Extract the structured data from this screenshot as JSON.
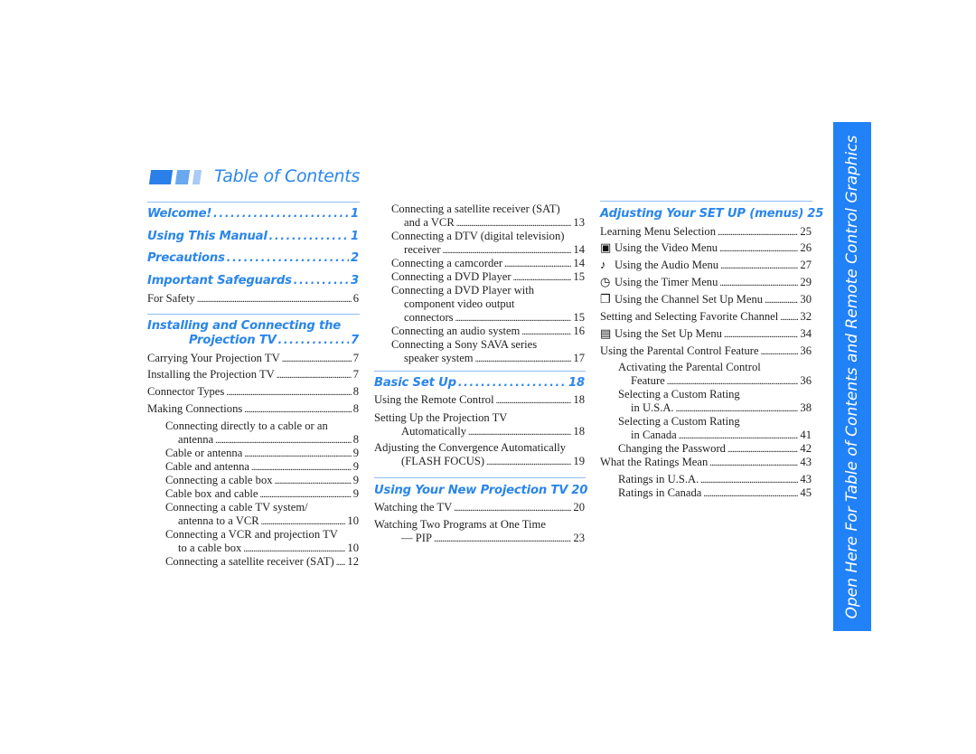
{
  "title": "Table of Contents",
  "side_tab": "Open Here For Table of Contents and Remote Control Graphics",
  "colors": {
    "accent": "#2a86ea",
    "tab": "#2181f7"
  },
  "columns": [
    {
      "entries": [
        {
          "heading": true,
          "lines": [
            "Welcome!"
          ],
          "page": "1"
        },
        {
          "heading": true,
          "lines": [
            "Using This Manual"
          ],
          "page": "1"
        },
        {
          "heading": true,
          "lines": [
            "Precautions"
          ],
          "page": "2"
        },
        {
          "heading": true,
          "lines": [
            "Important Safeguards"
          ],
          "page": "3"
        },
        {
          "lines": [
            "For Safety"
          ],
          "page": "6"
        },
        {
          "heading": true,
          "lines": [
            "Installing and Connecting the",
            "Projection TV"
          ],
          "page": "7"
        },
        {
          "lines": [
            "Carrying Your Projection TV"
          ],
          "page": "7"
        },
        {
          "lines": [
            "Installing the Projection TV"
          ],
          "page": "7"
        },
        {
          "lines": [
            "Connector Types"
          ],
          "page": "8"
        },
        {
          "lines": [
            "Making Connections"
          ],
          "page": "8"
        },
        {
          "lines": [
            "Connecting directly to a cable or an",
            "antenna"
          ],
          "page": "8"
        },
        {
          "lines": [
            "Cable or antenna"
          ],
          "page": "9"
        },
        {
          "lines": [
            "Cable and antenna"
          ],
          "page": "9"
        },
        {
          "lines": [
            "Connecting a cable box"
          ],
          "page": "9"
        },
        {
          "lines": [
            "Cable box and cable"
          ],
          "page": "9"
        },
        {
          "lines": [
            "Connecting a cable TV system/",
            "antenna to a VCR"
          ],
          "page": "10"
        },
        {
          "lines": [
            "Connecting a VCR and projection TV",
            "to a cable box"
          ],
          "page": "10"
        },
        {
          "lines": [
            "Connecting a satellite receiver (SAT)"
          ],
          "page": "12"
        }
      ]
    },
    {
      "entries": [
        {
          "lines": [
            "Connecting a satellite receiver (SAT)",
            "and a VCR"
          ],
          "page": "13"
        },
        {
          "lines": [
            "Connecting a DTV (digital television)",
            "receiver"
          ],
          "page": "14"
        },
        {
          "lines": [
            "Connecting a camcorder"
          ],
          "page": "14"
        },
        {
          "lines": [
            "Connecting a DVD Player"
          ],
          "page": "15"
        },
        {
          "lines": [
            "Connecting a DVD Player with",
            "component video output",
            "connectors"
          ],
          "page": "15"
        },
        {
          "lines": [
            "Connecting an audio system"
          ],
          "page": "16"
        },
        {
          "lines": [
            "Connecting a Sony SAVA series",
            "speaker system"
          ],
          "page": "17"
        },
        {
          "heading": true,
          "lines": [
            "Basic Set Up"
          ],
          "page": "18"
        },
        {
          "lines": [
            "Using the Remote Control"
          ],
          "page": "18"
        },
        {
          "lines": [
            "Setting Up the Projection TV",
            "Automatically"
          ],
          "page": "18"
        },
        {
          "lines": [
            "Adjusting the Convergence Automatically",
            "(FLASH FOCUS)"
          ],
          "page": "19"
        },
        {
          "heading": true,
          "lines": [
            "Using Your New Projection TV"
          ],
          "page": "20"
        },
        {
          "lines": [
            "Watching the TV"
          ],
          "page": "20"
        },
        {
          "lines": [
            "Watching Two Programs at One Time",
            "— PIP"
          ],
          "page": "23"
        }
      ]
    },
    {
      "entries": [
        {
          "heading": true,
          "lines": [
            "Adjusting Your SET UP (menus)"
          ],
          "page": "25"
        },
        {
          "lines": [
            "Learning Menu Selection"
          ],
          "page": "25"
        },
        {
          "icon": "video-menu-icon",
          "glyph": "▣",
          "lines": [
            "Using the Video Menu"
          ],
          "page": "26"
        },
        {
          "icon": "audio-menu-icon",
          "glyph": "♪",
          "lines": [
            "Using the Audio Menu"
          ],
          "page": "27"
        },
        {
          "icon": "timer-menu-icon",
          "glyph": "◷",
          "lines": [
            "Using the Timer Menu"
          ],
          "page": "29"
        },
        {
          "icon": "channel-menu-icon",
          "glyph": "❐",
          "lines": [
            "Using the Channel Set Up Menu"
          ],
          "page": "30"
        },
        {
          "lines": [
            "Setting and Selecting Favorite Channel"
          ],
          "page": "32"
        },
        {
          "icon": "setup-menu-icon",
          "glyph": "▤",
          "lines": [
            "Using the Set Up Menu"
          ],
          "page": "34"
        },
        {
          "lines": [
            "Using the Parental Control Feature"
          ],
          "page": "36"
        },
        {
          "lines": [
            "Activating the Parental Control",
            "Feature"
          ],
          "page": "36"
        },
        {
          "lines": [
            "Selecting a Custom Rating",
            "in U.S.A."
          ],
          "page": "38"
        },
        {
          "lines": [
            "Selecting a Custom Rating",
            "in Canada"
          ],
          "page": "41"
        },
        {
          "lines": [
            "Changing the Password"
          ],
          "page": "42"
        },
        {
          "lines": [
            "What the Ratings Mean"
          ],
          "page": "43"
        },
        {
          "lines": [
            "Ratings in U.S.A."
          ],
          "page": "43"
        },
        {
          "lines": [
            "Ratings in Canada"
          ],
          "page": "45"
        }
      ]
    }
  ]
}
